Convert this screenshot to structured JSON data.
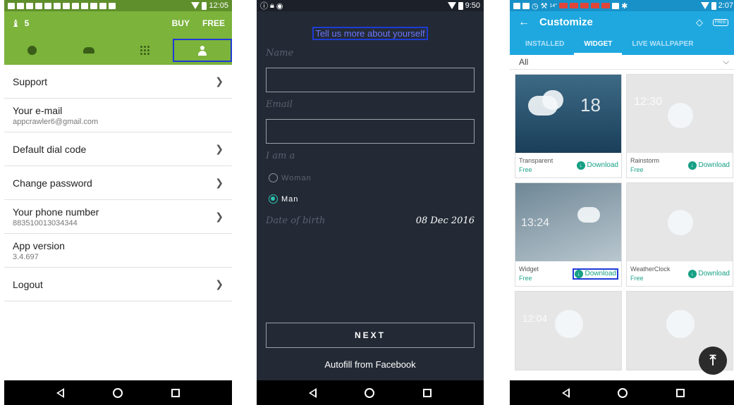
{
  "panel1": {
    "status_time": "12:05",
    "coin_count": "5",
    "buy_label": "BUY",
    "free_label": "FREE",
    "tabs": [
      "clock-icon",
      "contacts-icon",
      "dialpad-icon",
      "profile-icon"
    ],
    "selected_tab": 3,
    "rows": [
      {
        "label": "Support",
        "sub": "",
        "chevron": true
      },
      {
        "label": "Your e-mail",
        "sub": "appcrawler6@gmail.com",
        "chevron": false
      },
      {
        "label": "Default dial code",
        "sub": "",
        "chevron": true
      },
      {
        "label": "Change password",
        "sub": "",
        "chevron": true
      },
      {
        "label": "Your phone number",
        "sub": "883510013034344",
        "chevron": true
      },
      {
        "label": "App version",
        "sub": "3.4.697",
        "chevron": false
      },
      {
        "label": "Logout",
        "sub": "",
        "chevron": true
      }
    ],
    "accent": "#7bb33b"
  },
  "panel2": {
    "status_time": "9:50",
    "title": "Tell us more about yourself",
    "name_label": "Name",
    "email_label": "Email",
    "gender_label": "I am a",
    "option_woman": "Woman",
    "option_man": "Man",
    "selected_gender": "Man",
    "dob_label": "Date of birth",
    "dob_value": "08 Dec 2016",
    "next_label": "NEXT",
    "facebook_label": "Autofill from Facebook",
    "background": "#232a35"
  },
  "panel3": {
    "status_time": "2:07",
    "title": "Customize",
    "tabs": [
      "INSTALLED",
      "WIDGET",
      "LIVE WALLPAPER"
    ],
    "selected_tab": "WIDGET",
    "filter": "All",
    "cards": [
      {
        "name": "Transparent",
        "price": "Free",
        "download": "Download",
        "time": "18"
      },
      {
        "name": "Rainstorm",
        "price": "Free",
        "download": "Download",
        "time": "12:30"
      },
      {
        "name": "Widget",
        "price": "Free",
        "download": "Download",
        "time": "13:24"
      },
      {
        "name": "WeatherClock",
        "price": "Free",
        "download": "Download",
        "time": ""
      },
      {
        "name": "",
        "price": "",
        "download": "",
        "time": "12:04"
      },
      {
        "name": "",
        "price": "",
        "download": "",
        "time": ""
      }
    ],
    "accent": "#1fa8e0"
  }
}
